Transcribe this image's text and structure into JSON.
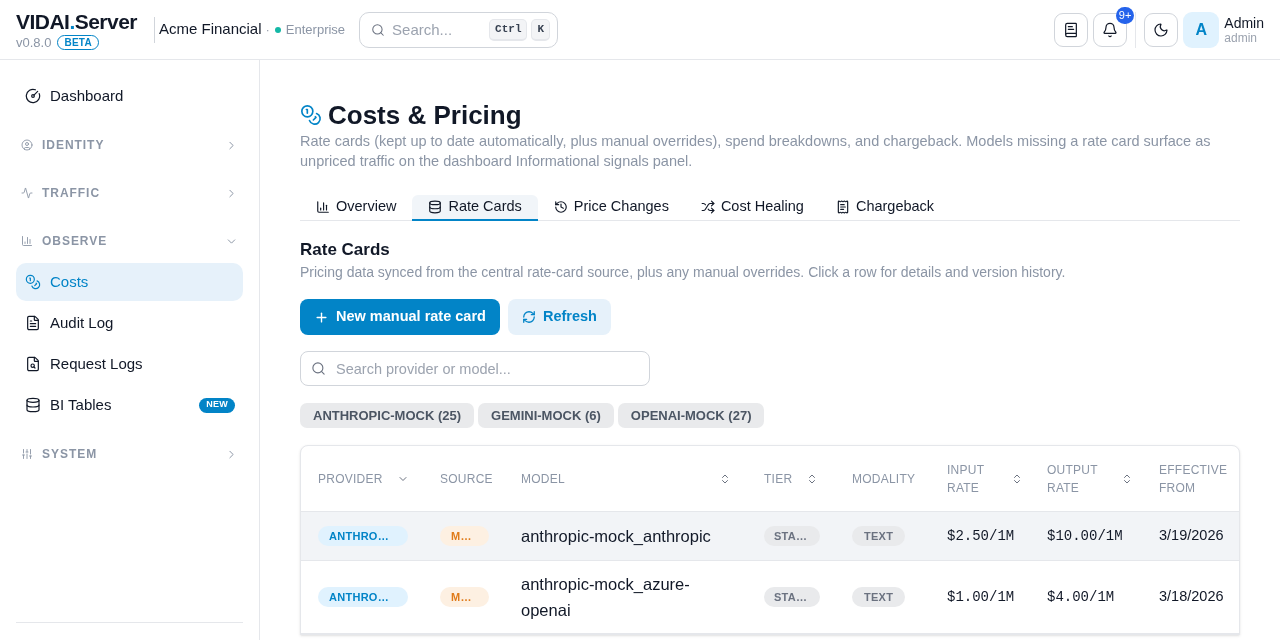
{
  "header": {
    "brand": {
      "name": "VIDAI",
      "separator": ".",
      "product": "Server"
    },
    "version": "v0.8.0",
    "release_badge": "BETA",
    "organization": "Acme Financial",
    "organization_separator": "·",
    "plan": "Enterprise",
    "search": {
      "placeholder": "Search...",
      "shortcut": [
        "Ctrl",
        "K"
      ]
    },
    "notification_count": "9+",
    "user": {
      "initial": "A",
      "name": "Admin",
      "username": "admin"
    }
  },
  "sidebar": {
    "items": [
      {
        "kind": "link",
        "label": "Dashboard",
        "selected": false
      },
      {
        "kind": "section",
        "label": "IDENTITY",
        "expanded": false
      },
      {
        "kind": "section",
        "label": "TRAFFIC",
        "expanded": false
      },
      {
        "kind": "section",
        "label": "OBSERVE",
        "expanded": true,
        "children": [
          {
            "label": "Costs",
            "selected": true
          },
          {
            "label": "Audit Log",
            "selected": false
          },
          {
            "label": "Request Logs",
            "selected": false
          },
          {
            "label": "BI Tables",
            "selected": false,
            "badge": "NEW"
          }
        ]
      },
      {
        "kind": "section",
        "label": "SYSTEM",
        "expanded": false
      }
    ]
  },
  "page": {
    "title": "Costs & Pricing",
    "description": "Rate cards (kept up to date automatically, plus manual overrides), spend breakdowns, and chargeback. Models missing a rate card surface as unpriced traffic on the dashboard Informational signals panel.",
    "tabs": [
      {
        "label": "Overview",
        "selected": false
      },
      {
        "label": "Rate Cards",
        "selected": true
      },
      {
        "label": "Price Changes",
        "selected": false
      },
      {
        "label": "Cost Healing",
        "selected": false
      },
      {
        "label": "Chargeback",
        "selected": false
      }
    ]
  },
  "rate_cards": {
    "title": "Rate Cards",
    "description": "Pricing data synced from the central rate-card source, plus any manual overrides. Click a row for details and version history.",
    "buttons": [
      {
        "label": "New manual rate card",
        "kind": "primary"
      },
      {
        "label": "Refresh",
        "kind": "secondary"
      }
    ],
    "search": {
      "placeholder": "Search provider or model..."
    },
    "filters": [
      "ANTHROPIC-MOCK (25)",
      "GEMINI-MOCK (6)",
      "OPENAI-MOCK (27)"
    ],
    "table": {
      "columns": [
        {
          "label": "PROVIDER",
          "sorted": true
        },
        {
          "label": "SOURCE",
          "sortable": false,
          "sorted": false
        },
        {
          "label": "MODEL",
          "sortable": true,
          "sorted": false
        },
        {
          "label": "TIER",
          "sortable": true,
          "sorted": false
        },
        {
          "label": "MODALITY",
          "sortable": false,
          "sorted": false
        },
        {
          "label": "INPUT RATE",
          "sortable": true,
          "sorted": false
        },
        {
          "label": "OUTPUT RATE",
          "sortable": true,
          "sorted": false
        },
        {
          "label": "EFFECTIVE FROM",
          "sortable": false,
          "sorted": false
        }
      ],
      "rows": [
        {
          "provider": "ANTHRO…",
          "source": "M…",
          "model": "anthropic-mock_anthropic",
          "tier": "STA…",
          "modality": "TEXT",
          "input_rate": "$2.50/1M",
          "output_rate": "$10.00/1M",
          "effective_from": "3/19/2026",
          "highlighted": true
        },
        {
          "provider": "ANTHRO…",
          "source": "M…",
          "model": "anthropic-mock_azure-openai",
          "tier": "STA…",
          "modality": "TEXT",
          "input_rate": "$1.00/1M",
          "output_rate": "$4.00/1M",
          "effective_from": "3/18/2026",
          "highlighted": false
        }
      ]
    }
  }
}
